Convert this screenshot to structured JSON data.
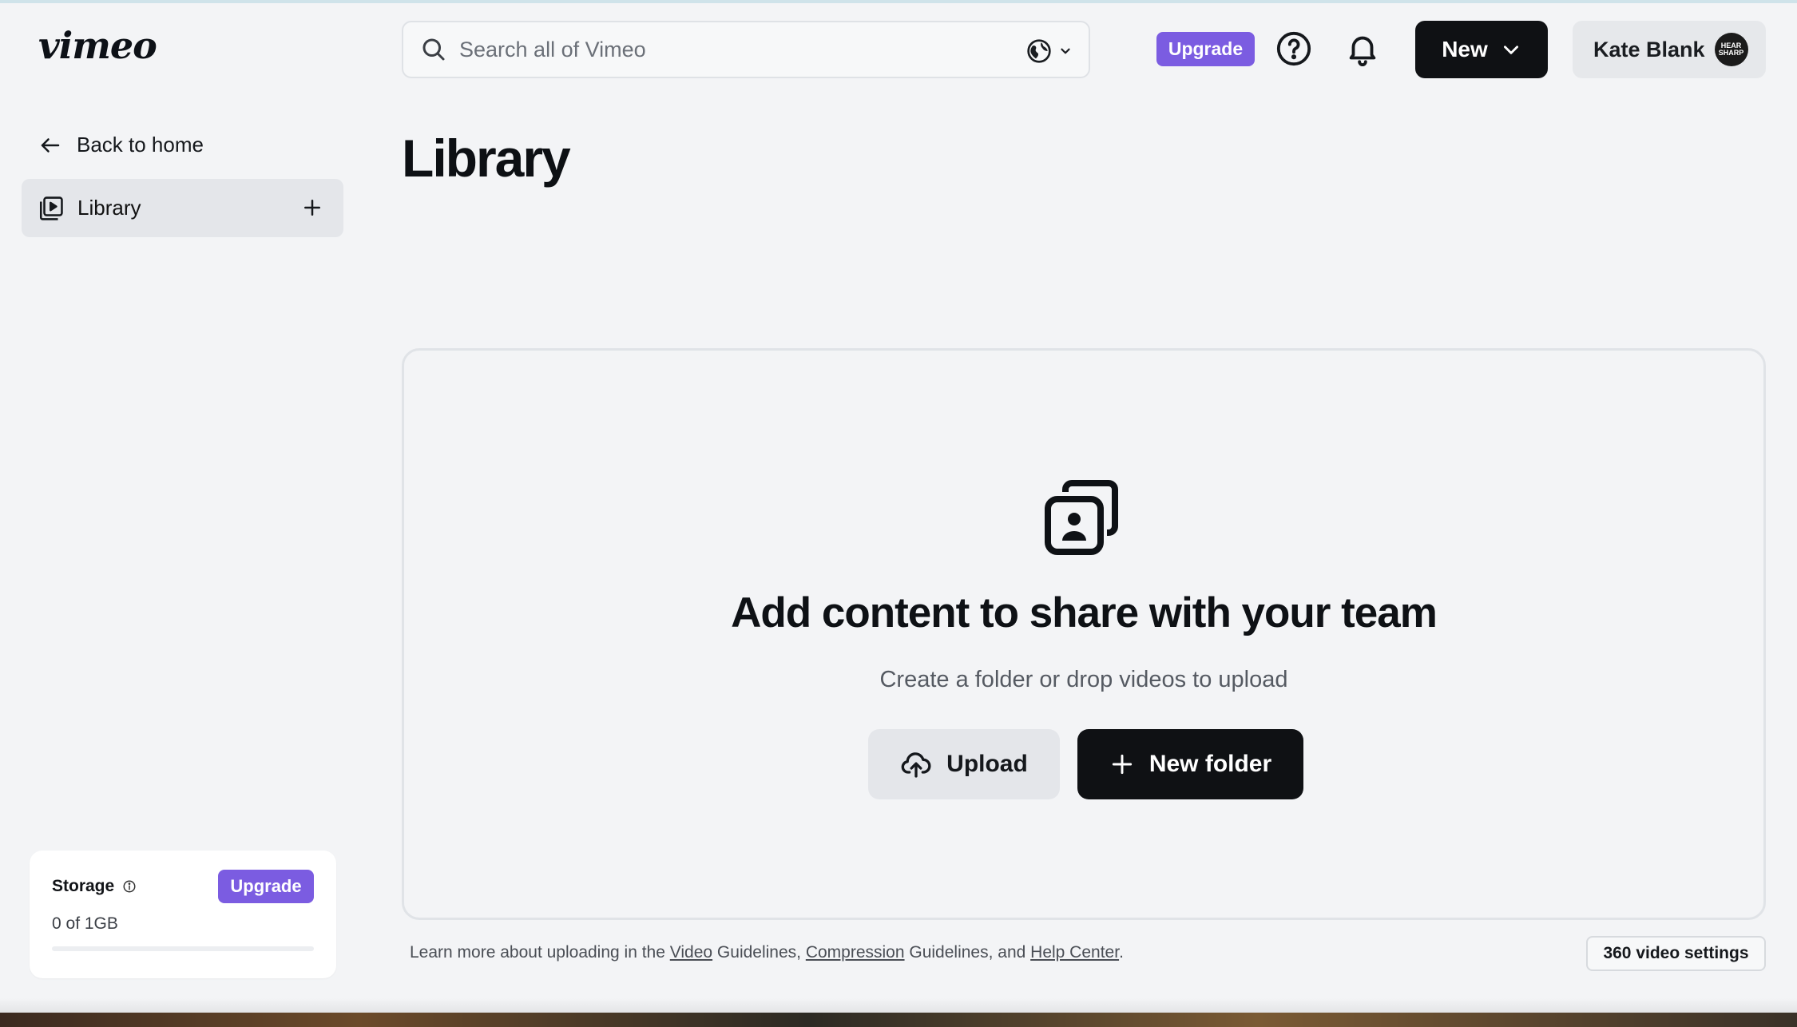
{
  "brand": {
    "logo": "vimeo",
    "accent": "#7b5ce1",
    "dark": "#0f1114"
  },
  "header": {
    "search": {
      "placeholder": "Search all of Vimeo",
      "value": "",
      "scope_icon": "globe-icon"
    },
    "upgrade_label": "Upgrade",
    "help_icon": "help-circle-icon",
    "notifications_icon": "bell-icon",
    "new_label": "New",
    "account": {
      "name": "Kate Blank",
      "avatar_text": "HEAR SHARP"
    }
  },
  "sidebar": {
    "back_label": "Back to home",
    "items": [
      {
        "label": "Library",
        "icon": "library-icon",
        "action_icon": "plus-icon",
        "active": true
      }
    ],
    "storage": {
      "title": "Storage",
      "info_icon": "info-icon",
      "upgrade_label": "Upgrade",
      "usage_text": "0 of 1GB",
      "used_fraction": 0
    }
  },
  "main": {
    "title": "Library",
    "empty_state": {
      "icon": "media-stack-icon",
      "heading": "Add content to share with your team",
      "subtext": "Create a folder or drop videos to upload",
      "upload_label": "Upload",
      "new_folder_label": "New folder"
    },
    "footer": {
      "prefix": "Learn more about uploading in the ",
      "link_video": "Video",
      "mid1": " Guidelines, ",
      "link_compression": "Compression",
      "mid2": " Guidelines, and ",
      "link_help": "Help Center",
      "suffix": "."
    },
    "settings_360_label": "360 video settings"
  }
}
